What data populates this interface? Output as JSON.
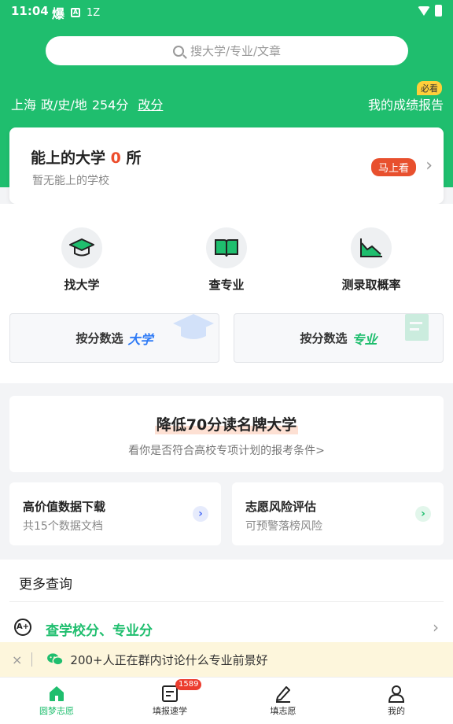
{
  "status_bar": {
    "time": "11:04",
    "hot_glyph": "爆",
    "a_box": "A",
    "speed": "1Z"
  },
  "search": {
    "placeholder": "搜大学/专业/文章"
  },
  "score": {
    "province": "上海",
    "subjects": "政/史/地",
    "score": "254分",
    "change_label": "改分"
  },
  "report": {
    "label": "我的成绩报告",
    "badge": "必看"
  },
  "main_card": {
    "title_prefix": "能上的大学",
    "count": "0",
    "title_suffix": "所",
    "subtitle": "暂无能上的学校",
    "button": "马上看"
  },
  "tools": [
    {
      "label": "找大学",
      "icon": "graduation-cap-icon"
    },
    {
      "label": "查专业",
      "icon": "open-book-icon"
    },
    {
      "label": "测录取概率",
      "icon": "area-chart-icon"
    }
  ],
  "pick": {
    "university": {
      "label": "按分数选",
      "highlight": "大学",
      "color": "#2f7bf6"
    },
    "major": {
      "label": "按分数选",
      "highlight": "专业",
      "color": "#1fbe6e"
    }
  },
  "promo": {
    "title": "降低70分读名牌大学",
    "subtitle": "看你是否符合高校专项计划的报考条件>"
  },
  "mini_cards": [
    {
      "title": "高价值数据下载",
      "subtitle": "共15个数据文档",
      "arrow_color": "#4a6cf7"
    },
    {
      "title": "志愿风险评估",
      "subtitle": "可预警落榜风险",
      "arrow_color": "#1fbe6e"
    }
  ],
  "more": {
    "heading": "更多查询",
    "item_label": "查学校分、专业分",
    "item_icon_text": "A+"
  },
  "notice": {
    "close": "×",
    "text": "200+人正在群内讨论什么专业前景好"
  },
  "tabs": [
    {
      "label": "圆梦志愿",
      "icon": "home-icon",
      "active": true
    },
    {
      "label": "填报速学",
      "icon": "document-icon",
      "badge": "1589"
    },
    {
      "label": "填志愿",
      "icon": "pen-icon"
    },
    {
      "label": "我的",
      "icon": "user-icon"
    }
  ],
  "colors": {
    "brand_green": "#1fbe6e",
    "accent_red": "#ec4d2c",
    "blue": "#2f7bf6"
  }
}
